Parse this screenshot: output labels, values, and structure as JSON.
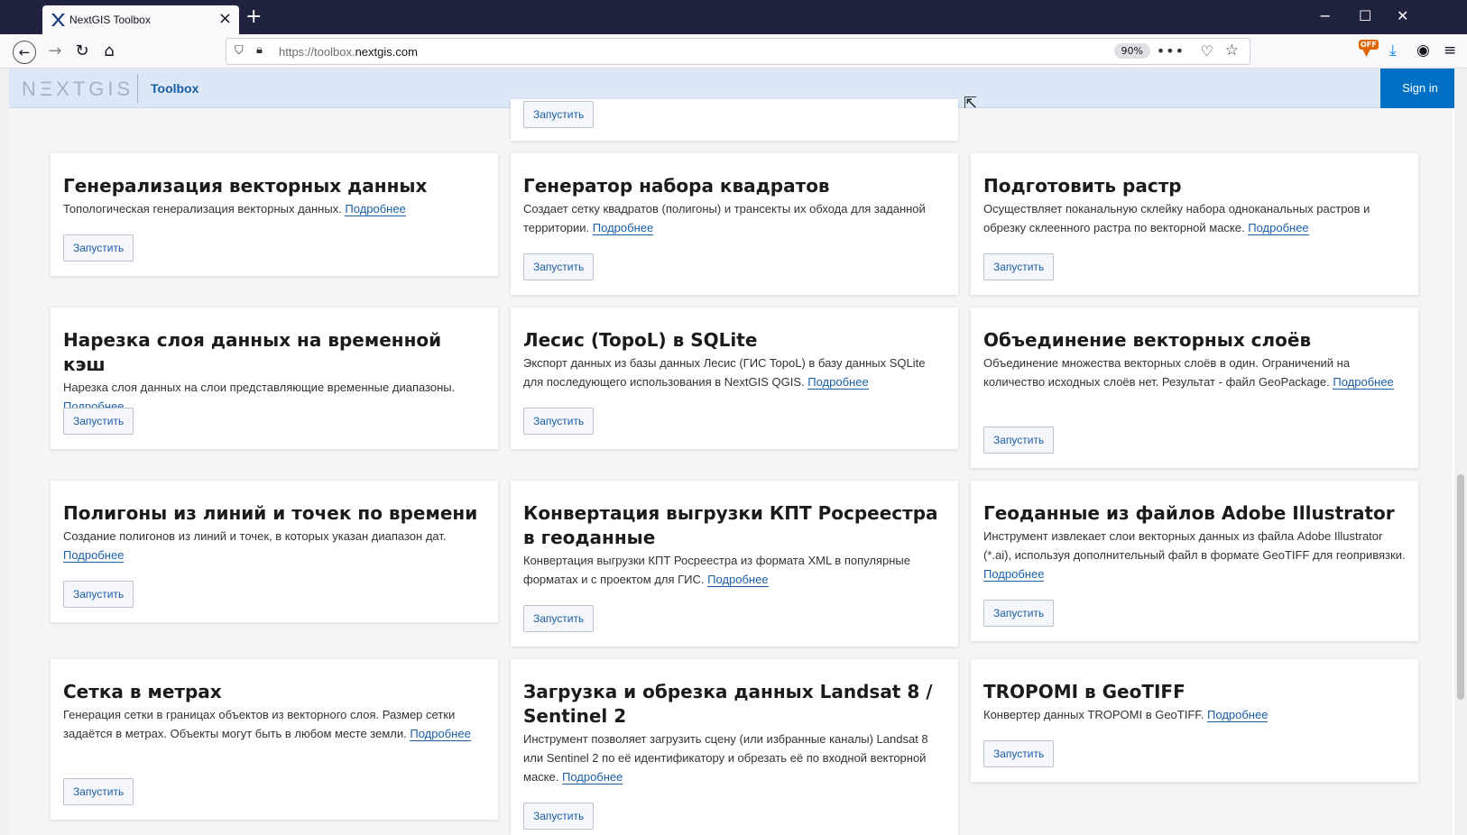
{
  "browser": {
    "tab_title": "NextGIS Toolbox",
    "tab_close": "×",
    "new_tab": "+",
    "url_prefix": "https://toolbox.",
    "url_domain": "nextgis.com",
    "zoom": "90%",
    "addon_badge": "OFF",
    "window_controls": {
      "minimize": "−",
      "maximize": "☐",
      "close": "✕"
    }
  },
  "header": {
    "logo": "NΞXTGIS",
    "title": "Toolbox",
    "signin": "Sign in"
  },
  "colors": {
    "accent": "#1a5ea8",
    "header_bg": "#dce8f5",
    "signin_bg": "#0070c5",
    "tabbar_bg": "#202340"
  },
  "run_label": "Запустить",
  "more_label": "Подробнее",
  "cards": [
    {
      "title": "",
      "desc": ""
    },
    {
      "title": "Генерализация векторных данных",
      "desc": "Топологическая генерализация векторных данных."
    },
    {
      "title": "Генератор набора квадратов",
      "desc": "Создает сетку квадратов (полигоны) и трансекты их обхода для заданной территории."
    },
    {
      "title": "Подготовить растр",
      "desc": "Осуществляет поканальную склейку набора одноканальных растров и обрезку склеенного растра по векторной маске."
    },
    {
      "title": "Нарезка слоя данных на временной кэш",
      "desc": "Нарезка слоя данных на слои представляющие временные диапазоны."
    },
    {
      "title": "Лесис (TopoL) в SQLite",
      "desc": "Экспорт данных из базы данных Лесис (ГИС TopoL) в базу данных SQLite для последующего использования в NextGIS QGIS."
    },
    {
      "title": "Объединение векторных слоёв",
      "desc": "Объединение множества векторных слоёв в один. Ограничений на количество исходных слоёв нет. Результат - файл GeoPackage."
    },
    {
      "title": "Полигоны из линий и точек по времени",
      "desc": "Создание полигонов из линий и точек, в которых указан диапазон дат."
    },
    {
      "title": "Конвертация выгрузки КПТ Росреестра в геоданные",
      "desc": "Конвертация выгрузки КПТ Росреестра из формата XML в популярные форматах и с проектом для ГИС."
    },
    {
      "title": "Геоданные из файлов Adobe Illustrator",
      "desc": "Инструмент извлекает слои векторных данных из файла Adobe Illustrator (*.ai), используя дополнительный файл в формате GeoTIFF для геопривязки."
    },
    {
      "title": "Сетка в метрах",
      "desc": "Генерация сетки в границах объектов из векторного слоя. Размер сетки задаётся в метрах. Объекты могут быть в любом месте земли."
    },
    {
      "title": "Загрузка и обрезка данных Landsat 8 / Sentinel 2",
      "desc": "Инструмент позволяет загрузить сцену (или избранные каналы) Landsat 8 или Sentinel 2 по её идентификатору и обрезать её по входной векторной маске."
    },
    {
      "title": "TROPOMI в GeoTIFF",
      "desc": "Конвертер данных TROPOMI в GeoTIFF."
    }
  ]
}
